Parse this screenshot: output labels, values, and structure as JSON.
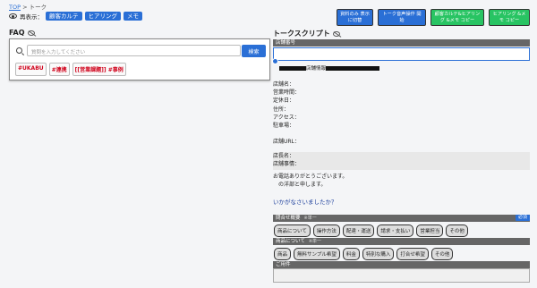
{
  "breadcrumb": {
    "top": "TOP",
    "sep": ">",
    "current": "トーク"
  },
  "redisplay": {
    "label": "再表示：",
    "pills": [
      "顧客カルテ",
      "ヒアリング",
      "メモ"
    ]
  },
  "top_buttons": [
    {
      "label": "資料のみ 表示に切替",
      "style": "blue"
    },
    {
      "label": "トーク音声操作 開始",
      "style": "blue2"
    },
    {
      "label": "顧客カルテ&ヒアリング &メモ コピー",
      "style": "green"
    },
    {
      "label": "ヒアリング &メモ コピー",
      "style": "green2"
    }
  ],
  "faq": {
    "title": "FAQ",
    "search_placeholder": "質問を入力してください",
    "search_button": "検索",
    "tags": [
      "#UKABU",
      "#連携",
      "[[営業課題]] #事例"
    ]
  },
  "talk_script": {
    "title": "トークスクリプト",
    "shop_number_label": "店舗番号",
    "shop_info_label": "店舗情報",
    "info_lines": [
      "店舗名：",
      "営業時間：",
      "定休日：",
      "住所：",
      "アクセス：",
      "駐車場："
    ],
    "url_label": "店舗URL：",
    "manager_lines": [
      "店長名：",
      "店舗事情："
    ],
    "greeting_lines": [
      "お電話ありがとうございます。",
      "　の洋部と申します。"
    ],
    "how_may": "いかがなさいましたか？",
    "inquiry": {
      "label": "問合せ概要",
      "note": "※単一",
      "required": "必須",
      "options": [
        "商品について",
        "操作方法",
        "配達・運送",
        "請求・支払い",
        "営業担当",
        "その他"
      ]
    },
    "product": {
      "label": "商品について",
      "note": "※単一",
      "options": [
        "商品",
        "無料サンプル希望",
        "料金",
        "特別な購入",
        "打合せ希望",
        "その他"
      ]
    },
    "memo_label": "ご用件"
  }
}
